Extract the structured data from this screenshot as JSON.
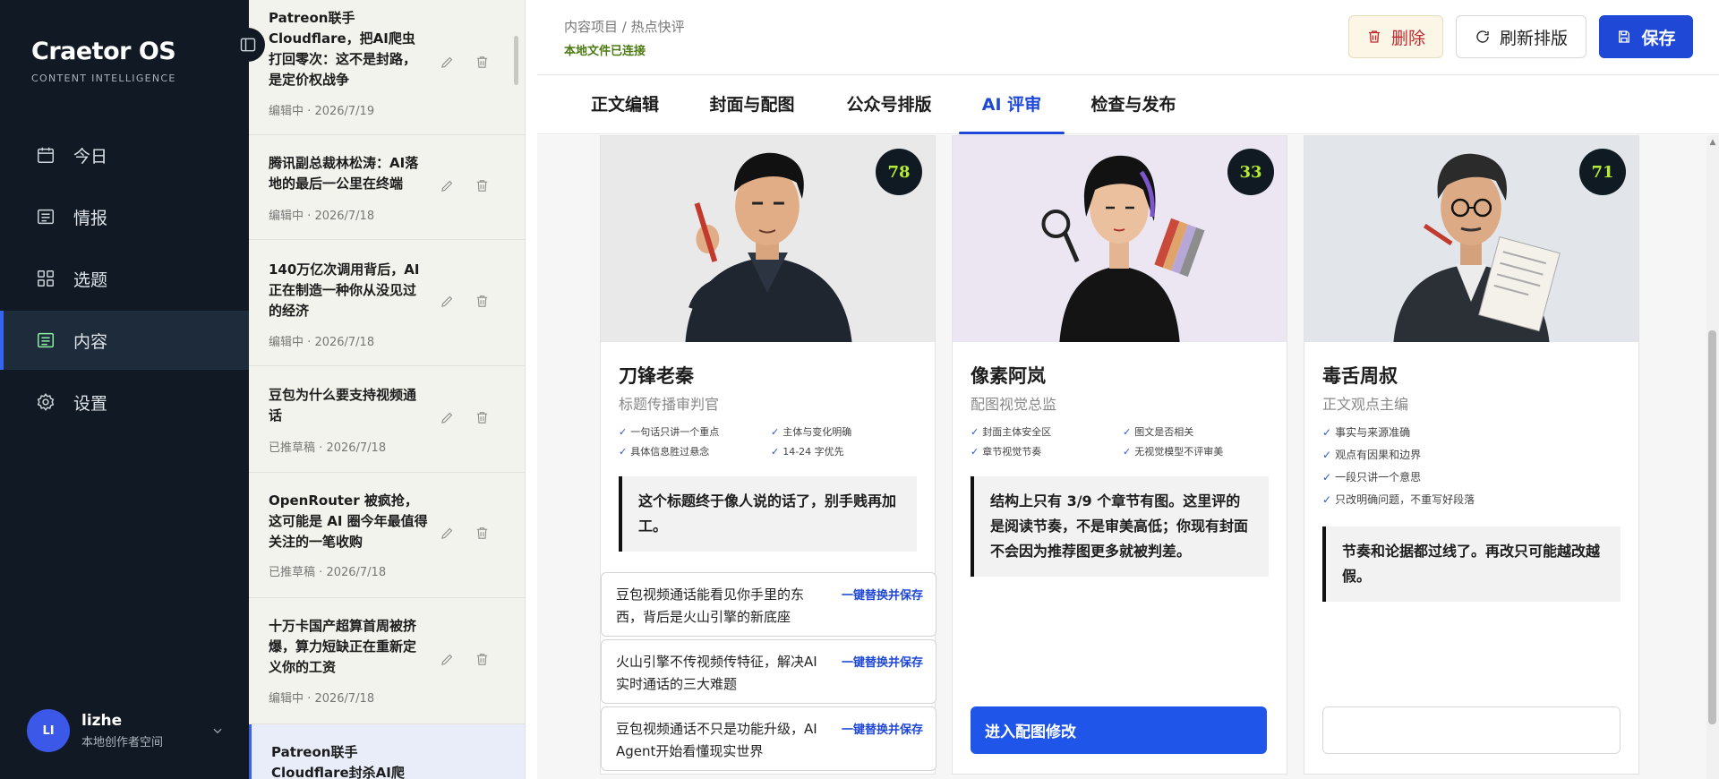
{
  "sidebar": {
    "brand_name": "Craetor OS",
    "brand_sub": "CONTENT INTELLIGENCE",
    "items": [
      {
        "label": "今日",
        "icon": "calendar-icon"
      },
      {
        "label": "情报",
        "icon": "newspaper-icon"
      },
      {
        "label": "选题",
        "icon": "grid-icon"
      },
      {
        "label": "内容",
        "icon": "document-icon",
        "active": true
      },
      {
        "label": "设置",
        "icon": "gear-icon"
      }
    ],
    "user": {
      "initials": "LI",
      "name": "lizhe",
      "workspace": "本地创作者空间"
    }
  },
  "doclist": {
    "items": [
      {
        "title": "Patreon联手Cloudflare，把AI爬虫打回零次：这不是封路，是定价权战争",
        "status": "编辑中",
        "date": "2026/7/19"
      },
      {
        "title": "腾讯副总裁林松涛：AI落地的最后一公里在终端",
        "status": "编辑中",
        "date": "2026/7/18"
      },
      {
        "title": "140万亿次调用背后，AI正在制造一种你从没见过的经济",
        "status": "编辑中",
        "date": "2026/7/18"
      },
      {
        "title": "豆包为什么要支持视频通话",
        "status": "已推草稿",
        "date": "2026/7/18"
      },
      {
        "title": "OpenRouter 被疯抢，这可能是 AI 圈今年最值得关注的一笔收购",
        "status": "已推草稿",
        "date": "2026/7/18"
      },
      {
        "title": "十万卡国产超算首周被挤爆，算力短缺正在重新定义你的工资",
        "status": "编辑中",
        "date": "2026/7/18"
      },
      {
        "title": "Patreon联手Cloudflare封杀AI爬",
        "status": "",
        "date": ""
      }
    ],
    "separator": "·"
  },
  "topbar": {
    "breadcrumb": "内容项目 / 热点快评",
    "status": "本地文件已连接",
    "delete_label": "删除",
    "refresh_label": "刷新排版",
    "save_label": "保存"
  },
  "tabs": [
    {
      "label": "正文编辑"
    },
    {
      "label": "封面与配图"
    },
    {
      "label": "公众号排版"
    },
    {
      "label": "AI 评审",
      "active": true
    },
    {
      "label": "检查与发布"
    }
  ],
  "reviewers": [
    {
      "name": "刀锋老秦",
      "role": "标题传播审判官",
      "score": "78",
      "checks": [
        "一句话只讲一个重点",
        "主体与变化明确",
        "具体信息胜过悬念",
        "14-24 字优先"
      ],
      "quote": "这个标题终于像人说的话了，别手贱再加工。",
      "suggestions": [
        {
          "text": "豆包视频通话能看见你手里的东西，背后是火山引擎的新底座",
          "action": "一键替换并保存"
        },
        {
          "text": "火山引擎不传视频传特征，解决AI实时通话的三大难题",
          "action": "一键替换并保存"
        },
        {
          "text": "豆包视频通话不只是功能升级，AI Agent开始看懂现实世界",
          "action": "一键替换并保存"
        }
      ]
    },
    {
      "name": "像素阿岚",
      "role": "配图视觉总监",
      "score": "33",
      "checks": [
        "封面主体安全区",
        "图文是否相关",
        "章节视觉节奏",
        "无视觉模型不评审美"
      ],
      "quote": "结构上只有 3/9 个章节有图。这里评的是阅读节奏，不是审美高低；你现有封面不会因为推荐图更多就被判差。",
      "cta": "进入配图修改"
    },
    {
      "name": "毒舌周叔",
      "role": "正文观点主编",
      "score": "71",
      "checks": [
        "事实与来源准确",
        "观点有因果和边界",
        "一段只讲一个意思",
        "只改明确问题，不重写好段落"
      ],
      "quote": "节奏和论据都过线了。再改只可能越改越假。"
    }
  ],
  "colors": {
    "accent": "#1f48d6",
    "score_text": "#b8ec34",
    "sidebar_bg": "#111a24",
    "danger": "#c0282d"
  }
}
